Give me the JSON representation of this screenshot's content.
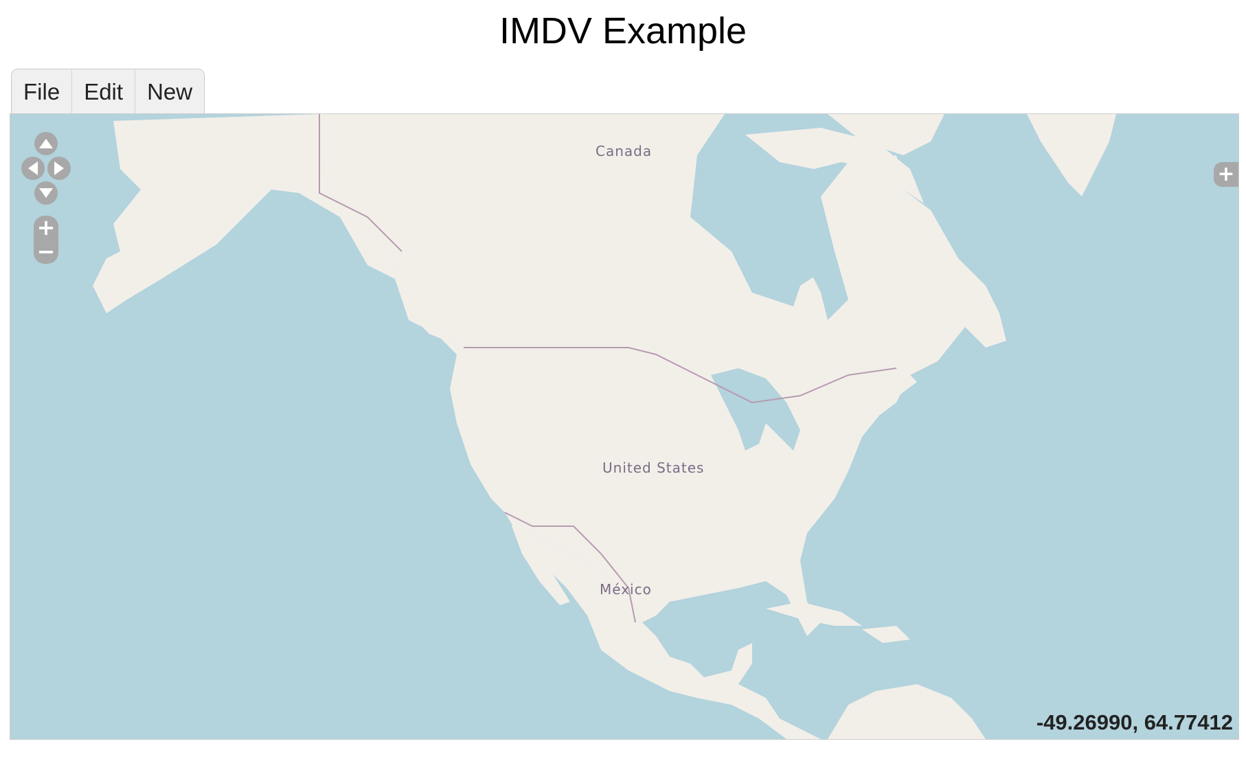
{
  "page": {
    "title": "IMDV Example"
  },
  "menu": {
    "items": [
      {
        "label": "File"
      },
      {
        "label": "Edit"
      },
      {
        "label": "New"
      }
    ]
  },
  "map": {
    "labels": {
      "canada": "Canada",
      "usa": "United States",
      "mexico": "México"
    },
    "mouse_position": "-49.26990, 64.77412",
    "colors": {
      "water": "#b3d3dd",
      "land": "#f2efe9",
      "border": "#b69bb0",
      "label": "#7b6b86",
      "controls": "#a8a8a8"
    },
    "controls": {
      "pan": [
        "pan-up-icon",
        "pan-left-icon",
        "pan-right-icon",
        "pan-down-icon"
      ],
      "zoom_in": "+",
      "zoom_out": "−",
      "layer_switcher": "+"
    }
  }
}
